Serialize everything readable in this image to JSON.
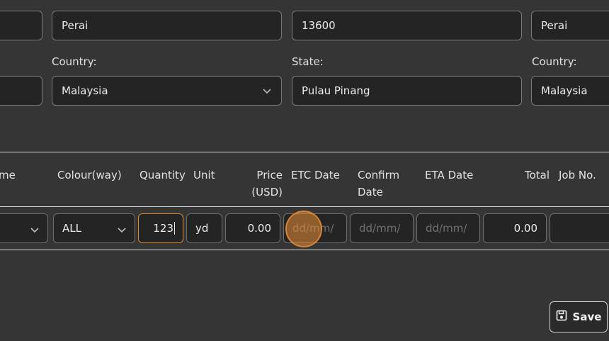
{
  "address": {
    "left_col": {
      "country_label": "Country:"
    },
    "mid_col": {
      "city_value": "Perai",
      "country_label": "Country:",
      "country_value": "Malaysia"
    },
    "postcode_col": {
      "postcode_value": "13600",
      "state_label": "State:",
      "state_value": "Pulau Pinang"
    },
    "right_col": {
      "city_value": "Perai",
      "country_label": "Country:",
      "country_value": "Malaysia"
    }
  },
  "table": {
    "headers": {
      "name_partial": "me",
      "colourway": "Colour(way)",
      "quantity": "Quantity",
      "unit": "Unit",
      "price_line1": "Price",
      "price_line2": "(USD)",
      "etc_date": "ETC Date",
      "confirm_line1": "Confirm",
      "confirm_line2": "Date",
      "eta_date": "ETA Date",
      "total": "Total",
      "job_no": "Job No."
    },
    "row": {
      "colourway": "ALL",
      "quantity": "123",
      "unit": "yd",
      "price": "0.00",
      "etc_date_placeholder": "dd/mm/",
      "confirm_date_placeholder": "dd/mm/",
      "eta_date_placeholder": "dd/mm/",
      "total": "0.00",
      "job_no": ""
    }
  },
  "actions": {
    "save_label": "Save"
  },
  "icons": {
    "chevron": "chevron-down-icon",
    "save": "floppy-disk-icon"
  },
  "colors": {
    "focus": "#e08a2e",
    "background": "#353535",
    "field": "#242424"
  }
}
